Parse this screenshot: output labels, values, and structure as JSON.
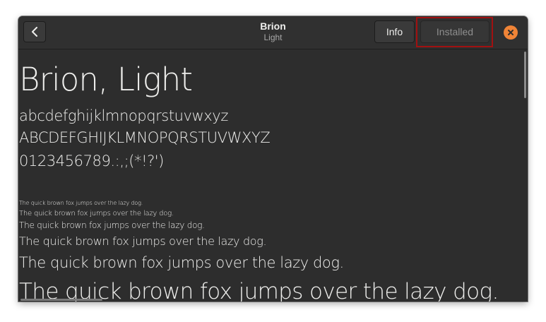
{
  "header": {
    "title": "Brion",
    "subtitle": "Light",
    "info_label": "Info",
    "install_label": "Installed"
  },
  "preview": {
    "heading": "Brion, Light",
    "lowercase": "abcdefghijklmnopqrstuvwxyz",
    "uppercase": "ABCDEFGHIJKLMNOPQRSTUVWXYZ",
    "digits": "0123456789.:,;(*!?')",
    "samples": [
      "The quick brown fox jumps over the lazy dog.",
      "The quick brown fox jumps over the lazy dog.",
      "The quick brown fox jumps over the lazy dog.",
      "The quick brown fox jumps over the lazy dog.",
      "The quick brown fox jumps over the lazy dog.",
      "The quick brown fox jumps over the lazy dog."
    ]
  },
  "icons": {
    "back": "go-previous-icon",
    "close": "window-close-icon"
  },
  "colors": {
    "window_bg": "#2d2d2d",
    "headerbar_bg": "#303030",
    "text": "#eeeeec",
    "close_accent": "#f08437",
    "highlight_border": "#a11111"
  }
}
